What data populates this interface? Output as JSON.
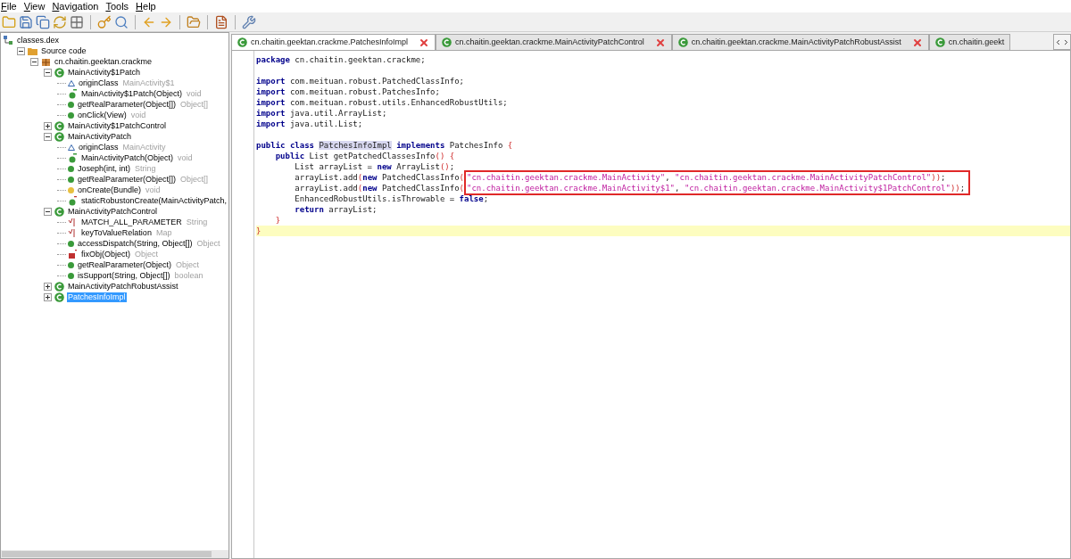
{
  "menu": [
    {
      "label": "File"
    },
    {
      "label": "View"
    },
    {
      "label": "Navigation"
    },
    {
      "label": "Tools"
    },
    {
      "label": "Help"
    }
  ],
  "toolbar": [
    {
      "kind": "folder"
    },
    {
      "kind": "save"
    },
    {
      "kind": "save-all"
    },
    {
      "kind": "sync"
    },
    {
      "kind": "grid"
    },
    {
      "kind": "sep"
    },
    {
      "kind": "key"
    },
    {
      "kind": "search"
    },
    {
      "kind": "sep"
    },
    {
      "kind": "back"
    },
    {
      "kind": "forward"
    },
    {
      "kind": "sep"
    },
    {
      "kind": "log"
    },
    {
      "kind": "sep"
    },
    {
      "kind": "doc"
    },
    {
      "kind": "sep"
    },
    {
      "kind": "wrench"
    }
  ],
  "tree": [
    {
      "kind": "root",
      "name": "classes.dex",
      "children": [
        {
          "kind": "folder",
          "name": "Source code",
          "expanded": true,
          "children": [
            {
              "kind": "package",
              "name": "cn.chaitin.geektan.crackme",
              "expanded": true,
              "children": [
                {
                  "kind": "class",
                  "name": "MainActivity$1Patch",
                  "expanded": true,
                  "selected": false,
                  "children": [
                    {
                      "kind": "field",
                      "name": "originClass",
                      "type": "MainActivity$1"
                    },
                    {
                      "kind": "constructor",
                      "name": "MainActivity$1Patch(Object)",
                      "type": "void"
                    },
                    {
                      "kind": "method",
                      "name": "getRealParameter(Object[])",
                      "type": "Object[]"
                    },
                    {
                      "kind": "method",
                      "name": "onClick(View)",
                      "type": "void"
                    }
                  ]
                },
                {
                  "kind": "class",
                  "name": "MainActivity$1PatchControl",
                  "expanded": false,
                  "selected": false
                },
                {
                  "kind": "class",
                  "name": "MainActivityPatch",
                  "expanded": true,
                  "selected": false,
                  "children": [
                    {
                      "kind": "field",
                      "name": "originClass",
                      "type": "MainActivity"
                    },
                    {
                      "kind": "constructor",
                      "name": "MainActivityPatch(Object)",
                      "type": "void"
                    },
                    {
                      "kind": "method",
                      "name": "Joseph(int, int)",
                      "type": "String"
                    },
                    {
                      "kind": "method",
                      "name": "getRealParameter(Object[])",
                      "type": "Object[]"
                    },
                    {
                      "kind": "protected",
                      "name": "onCreate(Bundle)",
                      "type": "void"
                    },
                    {
                      "kind": "static-method",
                      "name": "staticRobustonCreate(MainActivityPatch,"
                    }
                  ]
                },
                {
                  "kind": "class",
                  "name": "MainActivityPatchControl",
                  "expanded": true,
                  "selected": false,
                  "children": [
                    {
                      "kind": "static-field",
                      "name": "MATCH_ALL_PARAMETER",
                      "type": "String"
                    },
                    {
                      "kind": "static-field",
                      "name": "keyToValueRelation",
                      "type": "Map"
                    },
                    {
                      "kind": "method",
                      "name": "accessDispatch(String, Object[])",
                      "type": "Object"
                    },
                    {
                      "kind": "private-static",
                      "name": "fixObj(Object)",
                      "type": "Object"
                    },
                    {
                      "kind": "method",
                      "name": "getRealParameter(Object)",
                      "type": "Object"
                    },
                    {
                      "kind": "method",
                      "name": "isSupport(String, Object[])",
                      "type": "boolean"
                    }
                  ]
                },
                {
                  "kind": "class",
                  "name": "MainActivityPatchRobustAssist",
                  "expanded": false,
                  "selected": false
                },
                {
                  "kind": "class",
                  "name": "PatchesInfoImpl",
                  "expanded": false,
                  "selected": true
                }
              ]
            }
          ]
        }
      ]
    }
  ],
  "tabs": [
    {
      "label": "cn.chaitin.geektan.crackme.PatchesInfoImpl",
      "selected": true,
      "closable": true
    },
    {
      "label": "cn.chaitin.geektan.crackme.MainActivityPatchControl",
      "selected": false,
      "closable": true
    },
    {
      "label": "cn.chaitin.geektan.crackme.MainActivityPatchRobustAssist",
      "selected": false,
      "closable": true
    },
    {
      "label": "cn.chaitin.geekt",
      "selected": false,
      "closable": false
    }
  ],
  "code": [
    {
      "kind": "code",
      "highlight": false,
      "tokens": [
        {
          "kind": "kw",
          "text": "package"
        },
        {
          "kind": "plain",
          "text": " cn.chaitin.geektan.crackme;"
        }
      ]
    },
    {
      "kind": "blank"
    },
    {
      "kind": "code",
      "highlight": false,
      "tokens": [
        {
          "kind": "kw",
          "text": "import"
        },
        {
          "kind": "plain",
          "text": " com.meituan.robust.PatchedClassInfo;"
        }
      ]
    },
    {
      "kind": "code",
      "highlight": false,
      "tokens": [
        {
          "kind": "kw",
          "text": "import"
        },
        {
          "kind": "plain",
          "text": " com.meituan.robust.PatchesInfo;"
        }
      ]
    },
    {
      "kind": "code",
      "highlight": false,
      "tokens": [
        {
          "kind": "kw",
          "text": "import"
        },
        {
          "kind": "plain",
          "text": " com.meituan.robust.utils.EnhancedRobustUtils;"
        }
      ]
    },
    {
      "kind": "code",
      "highlight": false,
      "tokens": [
        {
          "kind": "kw",
          "text": "import"
        },
        {
          "kind": "plain",
          "text": " java.util.ArrayList;"
        }
      ]
    },
    {
      "kind": "code",
      "highlight": false,
      "tokens": [
        {
          "kind": "kw",
          "text": "import"
        },
        {
          "kind": "plain",
          "text": " java.util.List;"
        }
      ]
    },
    {
      "kind": "blank"
    },
    {
      "kind": "code",
      "highlight": false,
      "tokens": [
        {
          "kind": "kw",
          "text": "public class "
        },
        {
          "kind": "mark",
          "text": "PatchesInfoImpl"
        },
        {
          "kind": "kw",
          "text": " implements"
        },
        {
          "kind": "plain",
          "text": " PatchesInfo "
        },
        {
          "kind": "brace",
          "text": "{"
        }
      ]
    },
    {
      "kind": "code",
      "highlight": false,
      "tokens": [
        {
          "kind": "kw",
          "text": "    public"
        },
        {
          "kind": "plain",
          "text": " List getPatchedClassesInfo"
        },
        {
          "kind": "brace",
          "text": "() {"
        }
      ]
    },
    {
      "kind": "code",
      "highlight": false,
      "tokens": [
        {
          "kind": "plain",
          "text": "        List arrayList = "
        },
        {
          "kind": "kw",
          "text": "new"
        },
        {
          "kind": "plain",
          "text": " ArrayList"
        },
        {
          "kind": "brace",
          "text": "()"
        },
        {
          "kind": "plain",
          "text": ";"
        }
      ]
    },
    {
      "kind": "code",
      "highlight": false,
      "tokens": [
        {
          "kind": "plain",
          "text": "        arrayList.add"
        },
        {
          "kind": "brace",
          "text": "("
        },
        {
          "kind": "kw",
          "text": "new"
        },
        {
          "kind": "plain",
          "text": " PatchedClassInfo"
        },
        {
          "kind": "brace",
          "text": "("
        }
      ],
      "framed": [
        {
          "kind": "str",
          "text": "\"cn.chaitin.geektan.crackme.MainActivity\""
        },
        {
          "kind": "plain",
          "text": ", "
        },
        {
          "kind": "str",
          "text": "\"cn.chaitin.geektan.crackme.MainActivityPatchControl\""
        },
        {
          "kind": "brace",
          "text": "))"
        },
        {
          "kind": "plain",
          "text": ";"
        }
      ]
    },
    {
      "kind": "code",
      "highlight": false,
      "tokens": [
        {
          "kind": "plain",
          "text": "        arrayList.add"
        },
        {
          "kind": "brace",
          "text": "("
        },
        {
          "kind": "kw",
          "text": "new"
        },
        {
          "kind": "plain",
          "text": " PatchedClassInfo"
        },
        {
          "kind": "brace",
          "text": "("
        }
      ],
      "framed": [
        {
          "kind": "str",
          "text": "\"cn.chaitin.geektan.crackme.MainActivity$1\""
        },
        {
          "kind": "plain",
          "text": ", "
        },
        {
          "kind": "str",
          "text": "\"cn.chaitin.geektan.crackme.MainActivity$1PatchControl\""
        },
        {
          "kind": "brace",
          "text": "))"
        },
        {
          "kind": "plain",
          "text": ";"
        }
      ]
    },
    {
      "kind": "code",
      "highlight": false,
      "tokens": [
        {
          "kind": "plain",
          "text": "        EnhancedRobustUtils.isThrowable = "
        },
        {
          "kind": "kw",
          "text": "false"
        },
        {
          "kind": "plain",
          "text": ";"
        }
      ]
    },
    {
      "kind": "code",
      "highlight": false,
      "tokens": [
        {
          "kind": "kw",
          "text": "        return"
        },
        {
          "kind": "plain",
          "text": " arrayList;"
        }
      ]
    },
    {
      "kind": "code",
      "highlight": false,
      "tokens": [
        {
          "kind": "brace",
          "text": "    }"
        }
      ]
    },
    {
      "kind": "code",
      "highlight": true,
      "tokens": [
        {
          "kind": "brace",
          "text": "}"
        }
      ]
    }
  ]
}
